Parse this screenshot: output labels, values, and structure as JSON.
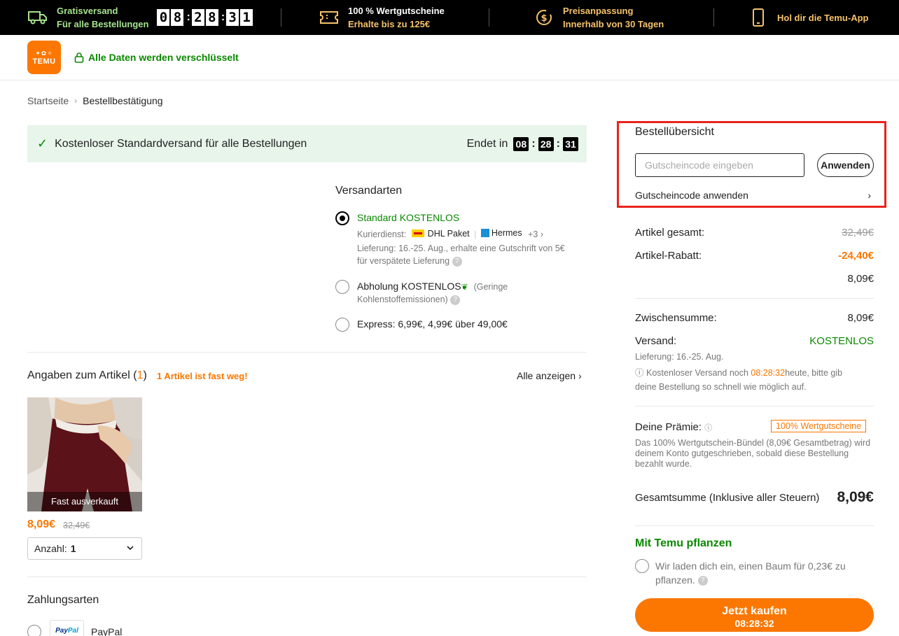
{
  "topbar": {
    "free_shipping_title": "Gratisversand",
    "free_shipping_sub": "Für alle Bestellungen",
    "timer_digits": [
      "0",
      "8",
      "2",
      "8",
      "3",
      "1"
    ],
    "voucher_title": "100 % Wertgutscheine",
    "voucher_sub": "Erhalte bis zu 125€",
    "price_adjust_title": "Preisanpassung",
    "price_adjust_sub": "Innerhalb von 30 Tagen",
    "app_label": "Hol dir die Temu-App"
  },
  "header": {
    "logo_text": "TEMU",
    "secure_text": "Alle Daten werden verschlüsselt"
  },
  "breadcrumb": {
    "home": "Startseite",
    "separator": "›",
    "current": "Bestellbestätigung"
  },
  "ship_banner": {
    "text": "Kostenloser Standardversand für alle Bestellungen",
    "ends_label": "Endet in",
    "hours": "08",
    "minutes": "28",
    "seconds": "31"
  },
  "shipping": {
    "title": "Versandarten",
    "standard": {
      "title": "Standard KOSTENLOS",
      "courier_label": "Kurierdienst:",
      "carrier1": "DHL Paket",
      "carrier2": "Hermes",
      "more": "+3",
      "delivery_line1": "Lieferung: 16.-25. Aug., erhalte eine Gutschrift von 5€",
      "delivery_line2": "für verspätete Lieferung"
    },
    "pickup": {
      "title": "Abholung KOSTENLOS",
      "note1": "(Geringe",
      "note2": "Kohlenstoffemissionen)"
    },
    "express": {
      "title": "Express: 6,99€, 4,99€ über 49,00€"
    }
  },
  "article": {
    "title_prefix": "Angaben zum Artikel (",
    "count": "1",
    "title_suffix": ")",
    "almost_gone": "1 Artikel ist fast weg!",
    "view_all": "Alle anzeigen",
    "overlay": "Fast ausverkauft",
    "price": "8,09€",
    "old_price": "32,49€",
    "qty_label": "Anzahl:",
    "qty_value": "1"
  },
  "payment": {
    "title": "Zahlungsarten",
    "paypal_logo": "PayPal",
    "paypal_label": "PayPal"
  },
  "summary": {
    "title": "Bestellübersicht",
    "coupon_placeholder": "Gutscheincode eingeben",
    "apply": "Anwenden",
    "coupon_link": "Gutscheincode anwenden",
    "items_total_label": "Artikel gesamt:",
    "items_total": "32,49€",
    "discount_label": "Artikel-Rabatt:",
    "discount": "-24,40€",
    "after_discount": "8,09€",
    "subtotal_label": "Zwischensumme:",
    "subtotal": "8,09€",
    "shipping_label": "Versand:",
    "shipping_value": "KOSTENLOS",
    "delivery": "Lieferung: 16.-25. Aug.",
    "free_note_prefix": "Kostenloser Versand noch ",
    "free_note_timer": "08:28:32",
    "free_note_suffix": "heute, bitte gib",
    "free_note_line2": "deine Bestellung so schnell wie möglich auf.",
    "reward_label": "Deine Prämie:",
    "reward_badge": "100% Wertgutscheine",
    "reward_text": "Das 100% Wertgutschein-Bündel (8,09€ Gesamtbetrag) wird deinem Konto gutgeschrieben, sobald diese Bestellung bezahlt wurde.",
    "total_label": "Gesamtsumme (Inklusive aller Steuern)",
    "total": "8,09€",
    "plant_title": "Mit Temu pflanzen",
    "plant_text": "Wir laden dich ein, einen Baum für 0,23€ zu pflanzen.",
    "buy_label": "Jetzt kaufen",
    "buy_timer": "08:28:32"
  },
  "colors": {
    "accent": "#fb7701",
    "green": "#0a8800",
    "highlight": "#e8231d"
  }
}
